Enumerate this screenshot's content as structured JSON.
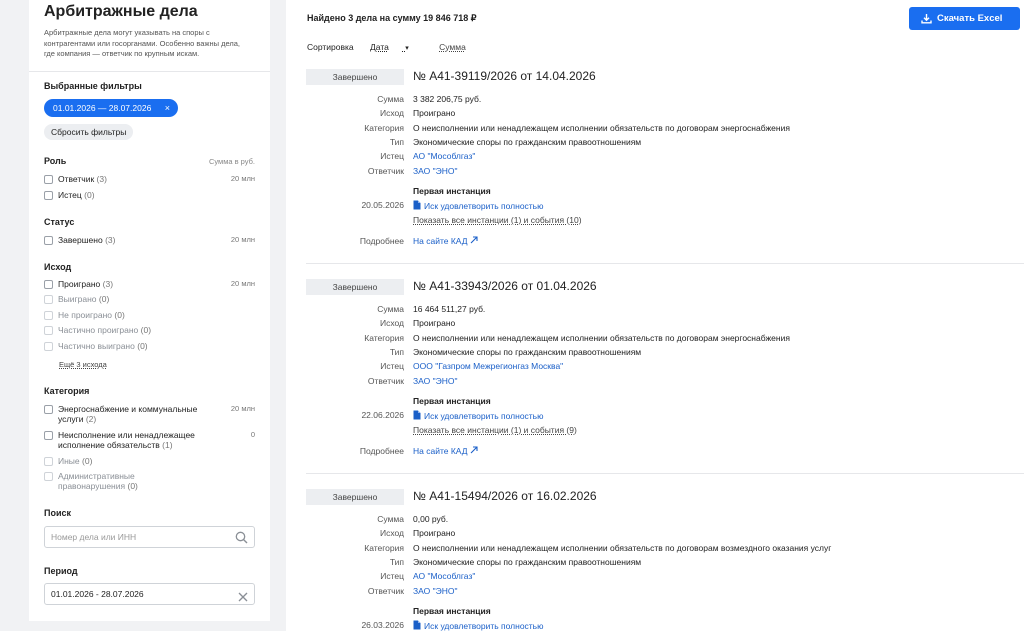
{
  "sidebar": {
    "title": "Арбитражные дела",
    "description": "Арбитражные дела могут указывать на споры с контрагентами или госорганами. Особенно важны дела, где компания — ответчик по крупным искам.",
    "selected_filters_title": "Выбранные фильтры",
    "chip_label": "01.01.2026 — 28.07.2026",
    "chip_close": "×",
    "reset_label": "Сбросить фильтры",
    "sum_header": "Сумма в руб.",
    "role": {
      "title": "Роль",
      "items": [
        {
          "label": "Ответчик",
          "count": "(3)",
          "amount": "20 млн"
        },
        {
          "label": "Истец",
          "count": "(0)",
          "amount": ""
        }
      ]
    },
    "status": {
      "title": "Статус",
      "items": [
        {
          "label": "Завершено",
          "count": "(3)",
          "amount": "20 млн"
        }
      ]
    },
    "outcome": {
      "title": "Исход",
      "items": [
        {
          "label": "Проиграно",
          "count": "(3)",
          "amount": "20 млн"
        },
        {
          "label": "Выиграно",
          "count": "(0)",
          "amount": ""
        },
        {
          "label": "Не проиграно",
          "count": "(0)",
          "amount": ""
        },
        {
          "label": "Частично проиграно",
          "count": "(0)",
          "amount": ""
        },
        {
          "label": "Частично выиграно",
          "count": "(0)",
          "amount": ""
        }
      ],
      "more_label": "Ещё 3 исхода"
    },
    "category": {
      "title": "Категория",
      "items": [
        {
          "label": "Энергоснабжение и коммунальные услуги",
          "count": "(2)",
          "amount": "20 млн"
        },
        {
          "label": "Неисполнение или ненадлежащее исполнение обязательств",
          "count": "(1)",
          "amount": "0"
        },
        {
          "label": "Иные",
          "count": "(0)",
          "amount": ""
        },
        {
          "label": "Административные правонарушения",
          "count": "(0)",
          "amount": ""
        }
      ]
    },
    "search": {
      "title": "Поиск",
      "placeholder": "Номер дела или ИНН"
    },
    "period": {
      "title": "Период",
      "value": "01.01.2026 - 28.07.2026"
    }
  },
  "main": {
    "found_text": "Найдено 3 дела на сумму 19 846 718 ₽",
    "excel_label": "Скачать Excel",
    "sort": {
      "label": "Сортировка",
      "date": "Дата",
      "date_arrow": "▾",
      "sum": "Сумма"
    },
    "labels": {
      "sum": "Сумма",
      "outcome": "Исход",
      "category": "Категория",
      "type": "Тип",
      "plaintiff": "Истец",
      "defendant": "Ответчик",
      "first_instance": "Первая инстанция",
      "details": "Подробнее",
      "kad_link": "На сайте КАД"
    },
    "cases": [
      {
        "status": "Завершено",
        "title": "№ А41-39119/2026 от 14.04.2026",
        "sum": "3 382 206,75 руб.",
        "outcome": "Проиграно",
        "category": "О неисполнении или ненадлежащем исполнении обязательств по договорам энергоснабжения",
        "type": "Экономические споры по гражданским правоотношениям",
        "plaintiff": "АО \"Мособлгаз\"",
        "defendant": "ЗАО \"ЭНО\"",
        "inst_date": "20.05.2026",
        "inst_result": "Иск удовлетворить полностью",
        "show_all": "Показать все инстанции (1) и события (10)"
      },
      {
        "status": "Завершено",
        "title": "№ А41-33943/2026 от 01.04.2026",
        "sum": "16 464 511,27 руб.",
        "outcome": "Проиграно",
        "category": "О неисполнении или ненадлежащем исполнении обязательств по договорам энергоснабжения",
        "type": "Экономические споры по гражданским правоотношениям",
        "plaintiff": "ООО \"Газпром Межрегионгаз Москва\"",
        "defendant": "ЗАО \"ЭНО\"",
        "inst_date": "22.06.2026",
        "inst_result": "Иск удовлетворить полностью",
        "show_all": "Показать все инстанции (1) и события (9)"
      },
      {
        "status": "Завершено",
        "title": "№ А41-15494/2026 от 16.02.2026",
        "sum": "0,00 руб.",
        "outcome": "Проиграно",
        "category": "О неисполнении или ненадлежащем исполнении обязательств по договорам возмездного оказания услуг",
        "type": "Экономические споры по гражданским правоотношениям",
        "plaintiff": "АО \"Мособлгаз\"",
        "defendant": "ЗАО \"ЭНО\"",
        "inst_date": "26.03.2026",
        "inst_result": "Иск удовлетворить полностью",
        "show_all": ""
      }
    ]
  }
}
